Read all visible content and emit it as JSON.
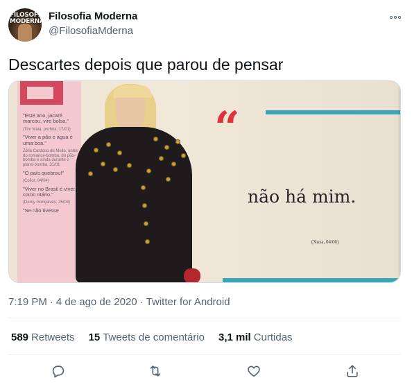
{
  "author": {
    "display_name": "Filosofia Moderna",
    "handle": "@FilosofiaMderna",
    "avatar_text": "FILOSOFIA MODERNA"
  },
  "tweet": {
    "text": "Descartes depois que parou de pensar"
  },
  "media": {
    "quote_text": "não há mim.",
    "quote_credit": "(Xuxa, 04/06)",
    "sidebar_quotes": [
      "\"Este ano, jacaré marcou, vire bolsa.\"",
      "(Tim Maia, profeta, 17/01)",
      "\"Viver a pão e água é uma boa.\"",
      "Zélia Cardoso de Mello, antes do romance-bomba, do pão-bomba e ainda durante o plano-bomba, 31/01",
      "\"O país quebrou!\"",
      "(Collor, 04/04)",
      "\"Viver no Brasil é viver como otário.\"",
      "(Dercy Gonçalves, 25/04)",
      "\"Se não tivesse"
    ]
  },
  "meta": {
    "time": "7:19 PM",
    "date": "4 de ago de 2020",
    "source": "Twitter for Android"
  },
  "stats": {
    "retweets_count": "589",
    "retweets_label": "Retweets",
    "quotes_count": "15",
    "quotes_label": "Tweets de comentário",
    "likes_count": "3,1 mil",
    "likes_label": "Curtidas"
  },
  "icons": {
    "reply": "reply-icon",
    "retweet": "retweet-icon",
    "like": "heart-icon",
    "share": "share-icon",
    "more": "more-icon"
  },
  "colors": {
    "text_primary": "#0f1419",
    "text_secondary": "#536471",
    "divider": "#eff3f4"
  }
}
